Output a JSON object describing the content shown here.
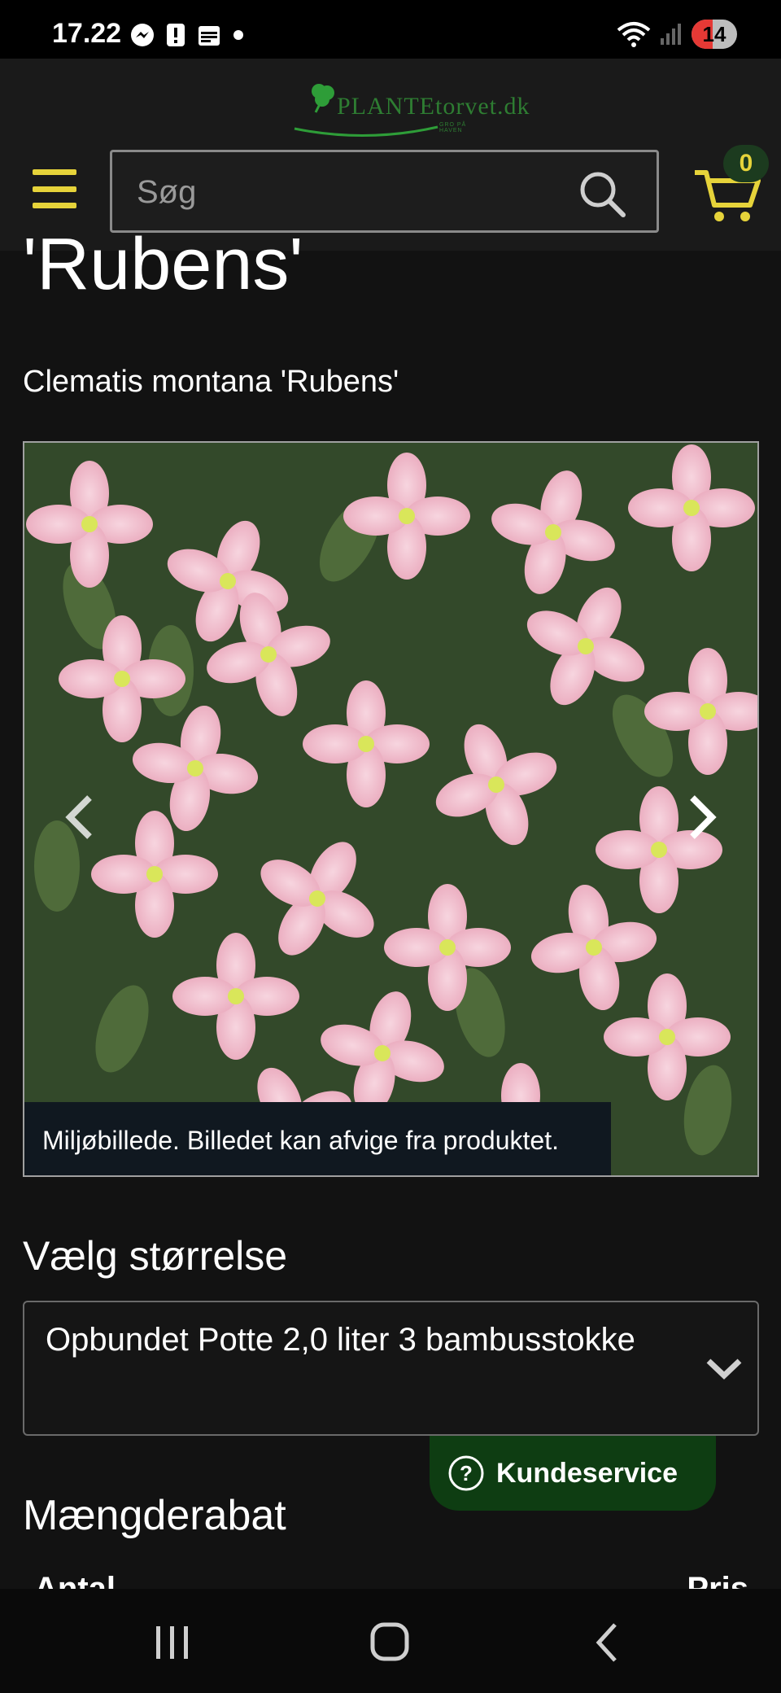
{
  "status_bar": {
    "time": "17.22",
    "battery": "14",
    "icons": [
      "messenger-icon",
      "alert-icon",
      "calendar-icon",
      "dot-icon",
      "wifi-icon",
      "signal-icon"
    ]
  },
  "header": {
    "logo_text": "PLANTEtorvet.dk",
    "logo_subtext": "GRO PÅ HAVEN",
    "search_placeholder": "Søg",
    "cart_count": "0",
    "accent_color": "#e6d33a"
  },
  "product": {
    "title_partial": "'Rubens'",
    "latin_name": "Clematis montana 'Rubens'",
    "image_caption": "Miljøbillede. Billedet kan afvige fra produktet."
  },
  "size_section": {
    "heading": "Vælg størrelse",
    "selected": "Opbundet Potte 2,0 liter 3 bambusstokke"
  },
  "customer_service": {
    "label": "Kundeservice"
  },
  "discount_section": {
    "heading": "Mængderabat",
    "col_amount": "Antal",
    "col_price": "Pris"
  }
}
